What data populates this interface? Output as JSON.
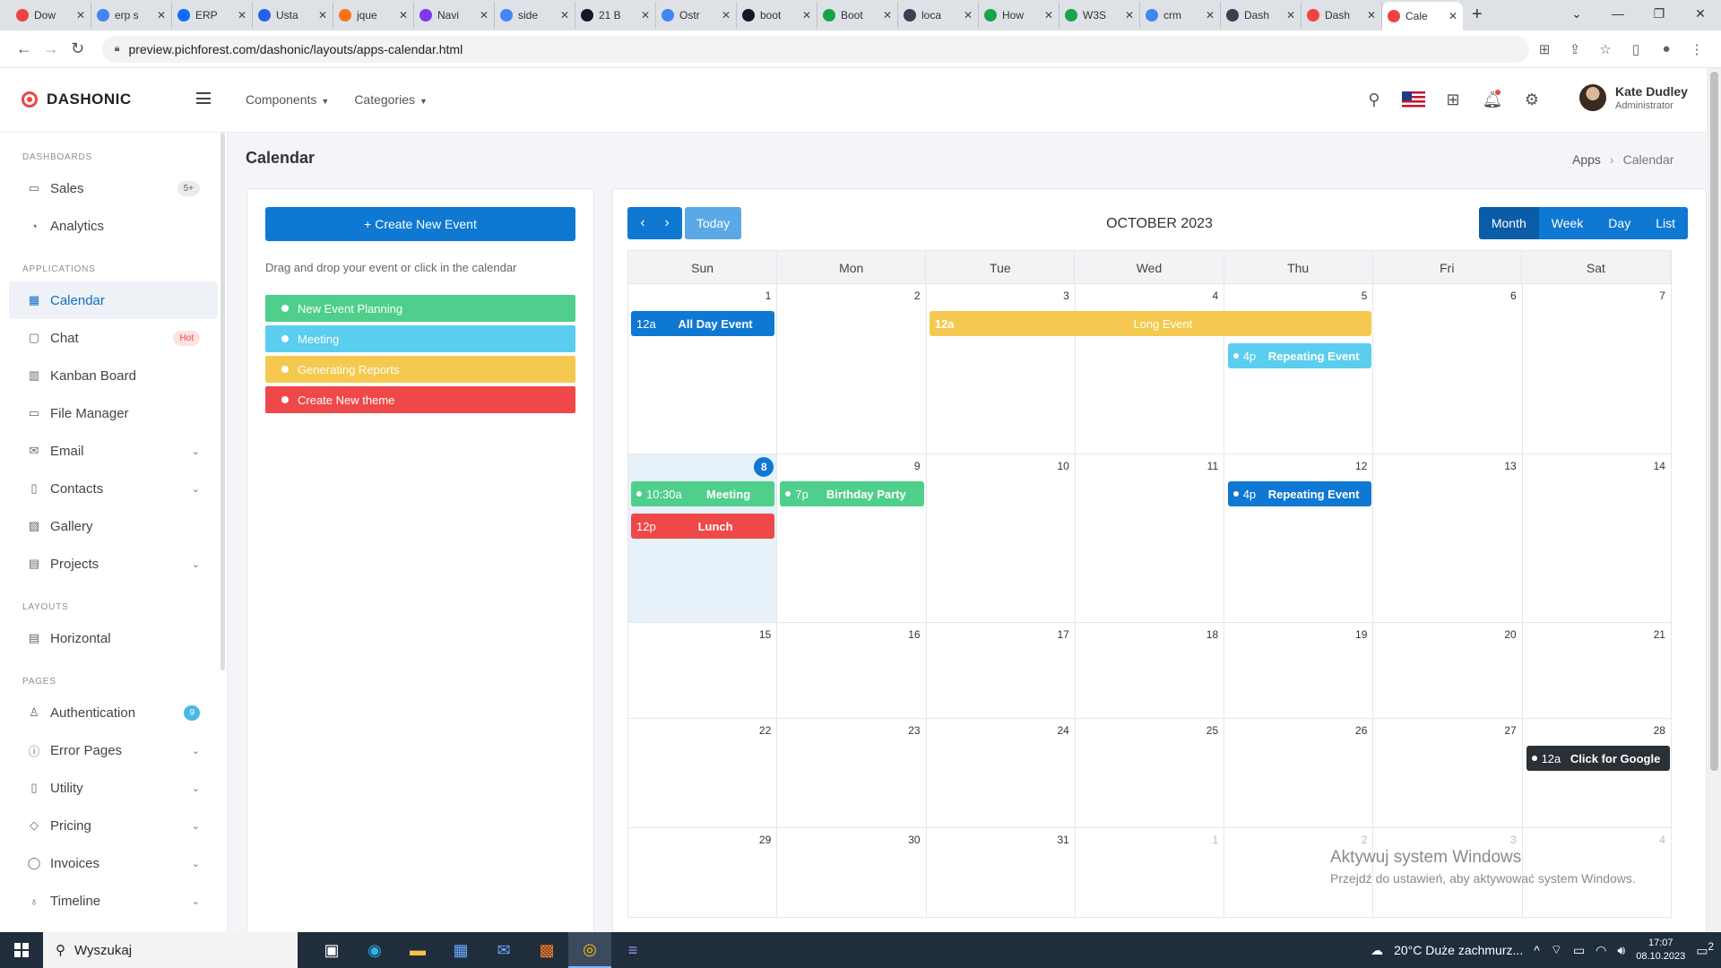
{
  "browser": {
    "tabs": [
      {
        "label": "Dow",
        "color": "#ef4444"
      },
      {
        "label": "erp s",
        "color": "#4285f4"
      },
      {
        "label": "ERP",
        "color": "#0d6efd"
      },
      {
        "label": "Usta",
        "color": "#2563eb"
      },
      {
        "label": "jque",
        "color": "#f97316"
      },
      {
        "label": "Navi",
        "color": "#7c3aed"
      },
      {
        "label": "side",
        "color": "#4285f4"
      },
      {
        "label": "21 B",
        "color": "#111827"
      },
      {
        "label": "Ostr",
        "color": "#4285f4"
      },
      {
        "label": "boot",
        "color": "#111827"
      },
      {
        "label": "Boot",
        "color": "#16a34a"
      },
      {
        "label": "loca",
        "color": "#374151"
      },
      {
        "label": "How",
        "color": "#16a34a"
      },
      {
        "label": "W3S",
        "color": "#16a34a"
      },
      {
        "label": "crm",
        "color": "#4285f4"
      },
      {
        "label": "Dash",
        "color": "#374151"
      },
      {
        "label": "Dash",
        "color": "#ef4444"
      },
      {
        "label": "Cale",
        "color": "#ef4444"
      }
    ],
    "url": "preview.pichforest.com/dashonic/layouts/apps-calendar.html"
  },
  "app": {
    "brand": "DASHONIC",
    "menu": [
      "Components",
      "Categories"
    ],
    "user": {
      "name": "Kate Dudley",
      "role": "Administrator"
    }
  },
  "sidebar": {
    "sections": [
      {
        "title": "DASHBOARDS",
        "items": [
          {
            "label": "Sales",
            "icon": "monitor-icon",
            "glyph": "▭",
            "badge": "5+",
            "badge_type": "count"
          },
          {
            "label": "Analytics",
            "icon": "pie-chart-icon",
            "glyph": "◔"
          }
        ]
      },
      {
        "title": "APPLICATIONS",
        "items": [
          {
            "label": "Calendar",
            "icon": "calendar-icon",
            "glyph": "▦",
            "active": true
          },
          {
            "label": "Chat",
            "icon": "chat-icon",
            "glyph": "▢",
            "badge": "Hot",
            "badge_type": "hot"
          },
          {
            "label": "Kanban Board",
            "icon": "kanban-icon",
            "glyph": "▥"
          },
          {
            "label": "File Manager",
            "icon": "folder-icon",
            "glyph": "▭"
          },
          {
            "label": "Email",
            "icon": "mail-icon",
            "glyph": "✉",
            "chevron": true
          },
          {
            "label": "Contacts",
            "icon": "contacts-icon",
            "glyph": "▯",
            "chevron": true
          },
          {
            "label": "Gallery",
            "icon": "image-icon",
            "glyph": "▨"
          },
          {
            "label": "Projects",
            "icon": "briefcase-icon",
            "glyph": "▤",
            "chevron": true
          }
        ]
      },
      {
        "title": "LAYOUTS",
        "items": [
          {
            "label": "Horizontal",
            "icon": "layout-icon",
            "glyph": "▤"
          }
        ]
      },
      {
        "title": "PAGES",
        "items": [
          {
            "label": "Authentication",
            "icon": "user-icon",
            "glyph": "♙",
            "badge": "9",
            "badge_type": "info"
          },
          {
            "label": "Error Pages",
            "icon": "alert-icon",
            "glyph": "ⓘ",
            "chevron": true
          },
          {
            "label": "Utility",
            "icon": "file-icon",
            "glyph": "▯",
            "chevron": true
          },
          {
            "label": "Pricing",
            "icon": "tag-icon",
            "glyph": "◇",
            "chevron": true
          },
          {
            "label": "Invoices",
            "icon": "invoice-icon",
            "glyph": "◯",
            "chevron": true
          },
          {
            "label": "Timeline",
            "icon": "award-icon",
            "glyph": "♁",
            "chevron": true
          }
        ]
      }
    ]
  },
  "page": {
    "title": "Calendar",
    "breadcrumb": [
      "Apps",
      "Calendar"
    ]
  },
  "external": {
    "create_label": "+ Create New Event",
    "hint": "Drag and drop your event or click in the calendar",
    "events": [
      {
        "label": "New Event Planning",
        "color": "#4fcf8b"
      },
      {
        "label": "Meeting",
        "color": "#5bcdee"
      },
      {
        "label": "Generating Reports",
        "color": "#f5c94f"
      },
      {
        "label": "Create New theme",
        "color": "#ef4848"
      }
    ]
  },
  "calendar": {
    "title": "OCTOBER 2023",
    "today_label": "Today",
    "views": [
      "Month",
      "Week",
      "Day",
      "List"
    ],
    "active_view": "Month",
    "days_of_week": [
      "Sun",
      "Mon",
      "Tue",
      "Wed",
      "Thu",
      "Fri",
      "Sat"
    ],
    "weeks": [
      {
        "days": [
          "1",
          "2",
          "3",
          "4",
          "5",
          "6",
          "7"
        ]
      },
      {
        "days": [
          "8",
          "9",
          "10",
          "11",
          "12",
          "13",
          "14"
        ]
      },
      {
        "days": [
          "15",
          "16",
          "17",
          "18",
          "19",
          "20",
          "21"
        ]
      },
      {
        "days": [
          "22",
          "23",
          "24",
          "25",
          "26",
          "27",
          "28"
        ]
      },
      {
        "days": [
          "29",
          "30",
          "31",
          "1",
          "2",
          "3",
          "4"
        ]
      }
    ],
    "today": "8",
    "events": [
      {
        "time": "12a",
        "title": "All Day Event",
        "color": "#0f78d2",
        "week": 0,
        "start": 0,
        "span": 1,
        "row": 0,
        "dot": false
      },
      {
        "time": "12a",
        "title": "Long Event",
        "color": "#f5c94f",
        "week": 0,
        "start": 2,
        "span": 3,
        "row": 0,
        "dot": false,
        "light": true
      },
      {
        "time": "4p",
        "title": "Repeating Event",
        "color": "#5bcdee",
        "week": 0,
        "start": 4,
        "span": 1,
        "row": 1,
        "dot": true
      },
      {
        "time": "10:30a",
        "title": "Meeting",
        "color": "#4fcf8b",
        "week": 1,
        "start": 0,
        "span": 1,
        "row": 0,
        "dot": true
      },
      {
        "time": "12p",
        "title": "Lunch",
        "color": "#ef4848",
        "week": 1,
        "start": 0,
        "span": 1,
        "row": 1,
        "dot": false
      },
      {
        "time": "7p",
        "title": "Birthday Party",
        "color": "#4fcf8b",
        "week": 1,
        "start": 1,
        "span": 1,
        "row": 0,
        "dot": true
      },
      {
        "time": "4p",
        "title": "Repeating Event",
        "color": "#0f78d2",
        "week": 1,
        "start": 4,
        "span": 1,
        "row": 0,
        "dot": true
      },
      {
        "time": "12a",
        "title": "Click for Google",
        "color": "#2b2f36",
        "week": 3,
        "start": 6,
        "span": 1,
        "row": 0,
        "dot": true
      }
    ]
  },
  "watermark": {
    "line1": "Aktywuj system Windows",
    "line2": "Przejdź do ustawień, aby aktywować system Windows."
  },
  "taskbar": {
    "search_placeholder": "Wyszukaj",
    "weather": "20°C  Duże zachmurz...",
    "time": "17:07",
    "date": "08.10.2023",
    "notifications": "2"
  }
}
